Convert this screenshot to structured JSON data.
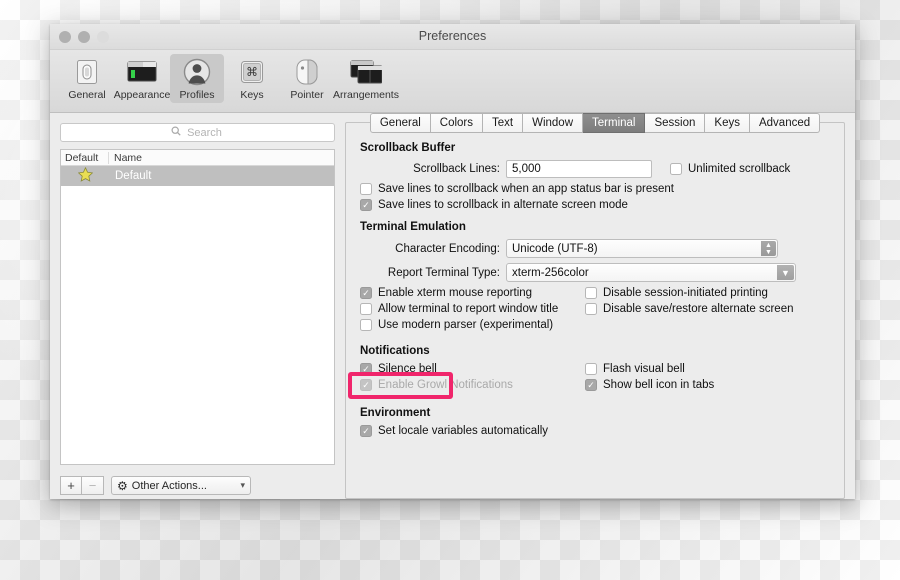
{
  "window": {
    "title": "Preferences"
  },
  "toolbar": {
    "items": [
      {
        "label": "General",
        "icon": "toggle-switch-icon"
      },
      {
        "label": "Appearance",
        "icon": "window-appearance-icon"
      },
      {
        "label": "Profiles",
        "icon": "person-silhouette-icon",
        "selected": true
      },
      {
        "label": "Keys",
        "icon": "command-key-icon"
      },
      {
        "label": "Pointer",
        "icon": "mouse-pointer-device-icon"
      },
      {
        "label": "Arrangements",
        "icon": "stacked-windows-icon"
      }
    ]
  },
  "sidebar": {
    "search": {
      "placeholder": "Search",
      "value": "",
      "icon": "search-icon"
    },
    "columns": [
      "Default",
      "Name"
    ],
    "rows": [
      {
        "star": "★",
        "name": "Default",
        "selected": true
      }
    ],
    "footer": {
      "add_label": "+",
      "remove_label": "−",
      "other_actions_label": "Other Actions...",
      "gear_icon": "gear-icon",
      "chevron_icon": "chevron-down-icon"
    }
  },
  "tabs": [
    {
      "label": "General",
      "selected": false
    },
    {
      "label": "Colors",
      "selected": false
    },
    {
      "label": "Text",
      "selected": false
    },
    {
      "label": "Window",
      "selected": false
    },
    {
      "label": "Terminal",
      "selected": true
    },
    {
      "label": "Session",
      "selected": false
    },
    {
      "label": "Keys",
      "selected": false
    },
    {
      "label": "Advanced",
      "selected": false
    }
  ],
  "panel": {
    "scrollback": {
      "heading": "Scrollback Buffer",
      "lines_label": "Scrollback Lines:",
      "lines_value": "5,000",
      "unlimited": {
        "label": "Unlimited scrollback",
        "checked": false
      },
      "save_status_bar": {
        "label": "Save lines to scrollback when an app status bar is present",
        "checked": false
      },
      "save_alternate": {
        "label": "Save lines to scrollback in alternate screen mode",
        "checked": true
      }
    },
    "emulation": {
      "heading": "Terminal Emulation",
      "encoding_label": "Character Encoding:",
      "encoding_value": "Unicode (UTF-8)",
      "termtype_label": "Report Terminal Type:",
      "termtype_value": "xterm-256color",
      "checks": [
        {
          "label": "Enable xterm mouse reporting",
          "checked": true,
          "col": 1
        },
        {
          "label": "Disable session-initiated printing",
          "checked": false,
          "col": 2
        },
        {
          "label": "Allow terminal to report window title",
          "checked": false,
          "col": 1
        },
        {
          "label": "Disable save/restore alternate screen",
          "checked": false,
          "col": 2
        },
        {
          "label": "Use modern parser (experimental)",
          "checked": false,
          "col": 1
        }
      ]
    },
    "notifications": {
      "heading": "Notifications",
      "silence_bell": {
        "label": "Silence bell",
        "checked": true,
        "highlighted": true
      },
      "growl": {
        "label": "Enable Growl Notifications",
        "checked": true,
        "dimmed": true
      },
      "flash_visual_bell": {
        "label": "Flash visual bell",
        "checked": false
      },
      "show_bell_icon": {
        "label": "Show bell icon in tabs",
        "checked": true
      }
    },
    "environment": {
      "heading": "Environment",
      "set_locale": {
        "label": "Set locale variables automatically",
        "checked": true
      }
    }
  },
  "colors": {
    "highlight": "#f0256b",
    "tab_selected_bg": "#8f8f8f",
    "star": "#e8dd55",
    "row_selected_bg": "#bfbfbf"
  }
}
